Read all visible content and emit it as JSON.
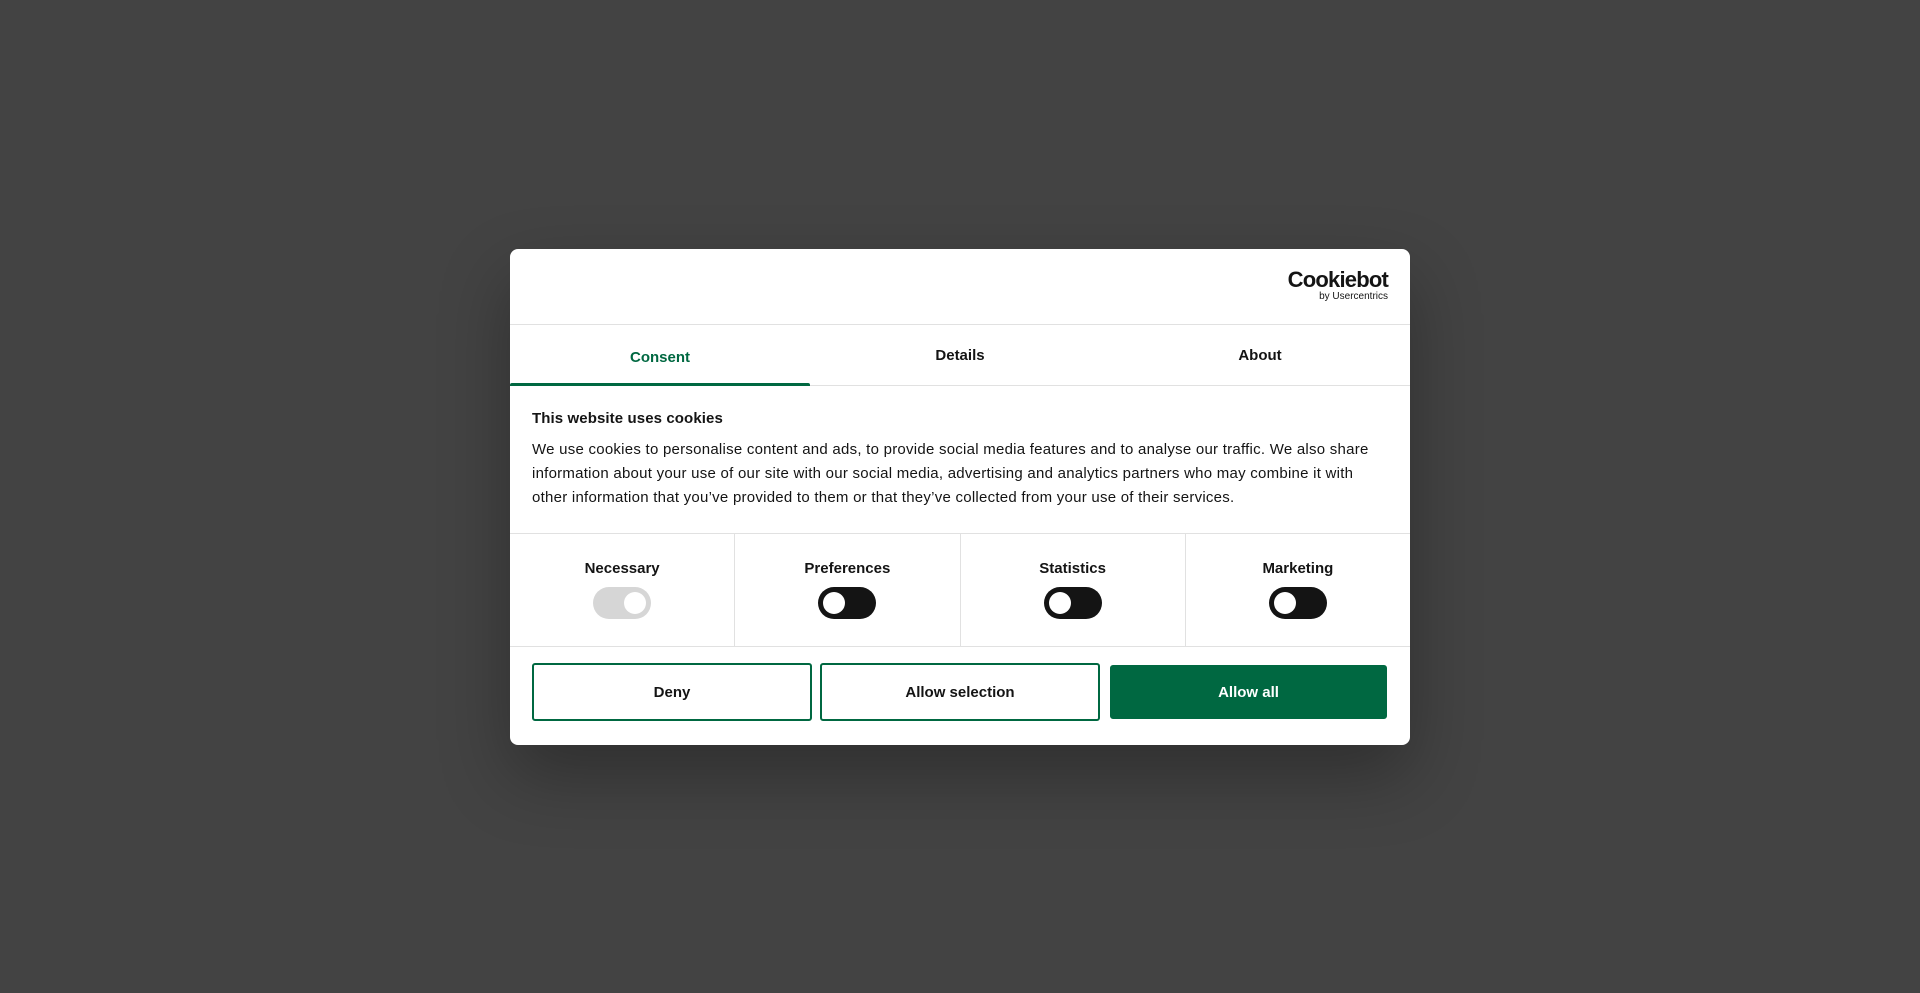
{
  "logo": {
    "word": "Cookiebot",
    "sub": "by Usercentrics"
  },
  "tabs": [
    {
      "label": "Consent",
      "active": true
    },
    {
      "label": "Details",
      "active": false
    },
    {
      "label": "About",
      "active": false
    }
  ],
  "consent": {
    "title": "This website uses cookies",
    "text": "We use cookies to personalise content and ads, to provide social media features and to analyse our traffic. We also share information about your use of our site with our social media, advertising and analytics partners who may combine it with other information that you’ve provided to them or that they’ve collected from your use of their services."
  },
  "toggles": [
    {
      "label": "Necessary",
      "enabled": true,
      "disabled": true
    },
    {
      "label": "Preferences",
      "enabled": false,
      "disabled": false
    },
    {
      "label": "Statistics",
      "enabled": false,
      "disabled": false
    },
    {
      "label": "Marketing",
      "enabled": false,
      "disabled": false
    }
  ],
  "buttons": {
    "deny": "Deny",
    "allow_selection": "Allow selection",
    "allow_all": "Allow all"
  },
  "colors": {
    "accent": "#006841",
    "backdrop": "#434343",
    "toggle_off": "#141414",
    "toggle_disabled": "#d6d6d6"
  }
}
